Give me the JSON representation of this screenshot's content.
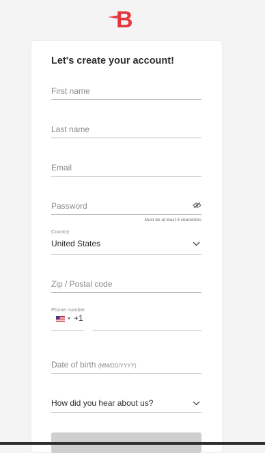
{
  "brand": {
    "logo_letter": "B",
    "accent": "#e4363d"
  },
  "form": {
    "title": "Let's create your account!",
    "first_name": {
      "placeholder": "First name"
    },
    "last_name": {
      "placeholder": "Last name"
    },
    "email": {
      "placeholder": "Email"
    },
    "password": {
      "placeholder": "Password",
      "hint": "Must be at least 6 characters",
      "toggle_icon": "eye-slash-icon"
    },
    "country": {
      "label": "Country",
      "value": "United States"
    },
    "zip": {
      "placeholder": "Zip / Postal code"
    },
    "phone": {
      "label": "Phone number",
      "country_flag": "us-flag-icon",
      "dial_code": "+1",
      "value": ""
    },
    "dob": {
      "placeholder": "Date of birth",
      "format_hint": "(MM/DD/YYYY)"
    },
    "referral": {
      "placeholder": "How did you hear about us?"
    },
    "submit_label": ""
  },
  "colors": {
    "background": "#f4f4f4",
    "card": "#ffffff",
    "line": "#bdbdbd",
    "button_disabled": "#cfcfcf"
  }
}
